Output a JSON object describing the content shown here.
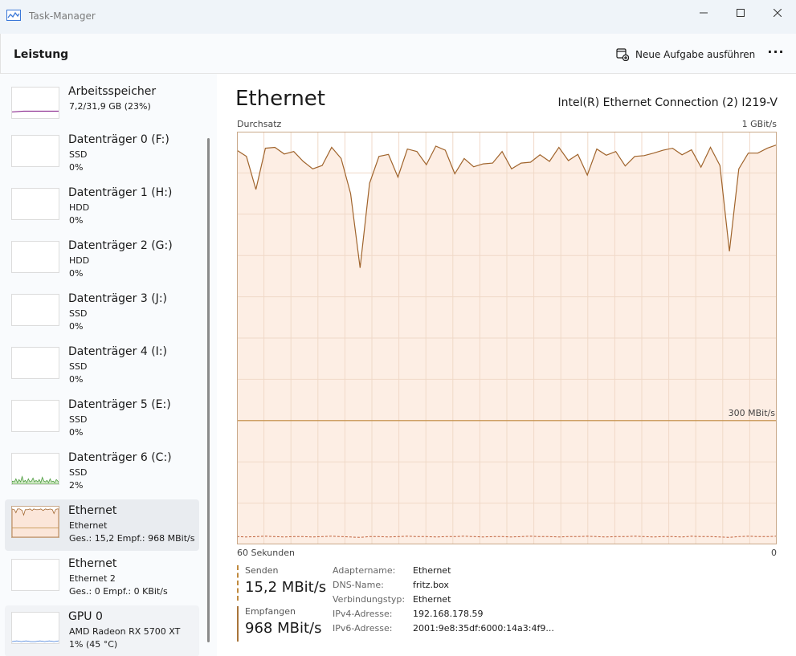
{
  "window": {
    "title": "Task-Manager"
  },
  "header": {
    "page_heading": "Leistung",
    "run_task_label": "Neue Aufgabe ausführen",
    "more_label": "···"
  },
  "sidebar": {
    "items": [
      {
        "title": "Arbeitsspeicher",
        "sub1": "7,2/31,9 GB (23%)",
        "sub2": ""
      },
      {
        "title": "Datenträger 0 (F:)",
        "sub1": "SSD",
        "sub2": "0%"
      },
      {
        "title": "Datenträger 1 (H:)",
        "sub1": "HDD",
        "sub2": "0%"
      },
      {
        "title": "Datenträger 2 (G:)",
        "sub1": "HDD",
        "sub2": "0%"
      },
      {
        "title": "Datenträger 3 (J:)",
        "sub1": "SSD",
        "sub2": "0%"
      },
      {
        "title": "Datenträger 4 (I:)",
        "sub1": "SSD",
        "sub2": "0%"
      },
      {
        "title": "Datenträger 5 (E:)",
        "sub1": "SSD",
        "sub2": "0%"
      },
      {
        "title": "Datenträger 6 (C:)",
        "sub1": "SSD",
        "sub2": "2%"
      },
      {
        "title": "Ethernet",
        "sub1": "Ethernet",
        "sub2": "Ges.: 15,2 Empf.: 968 MBit/s"
      },
      {
        "title": "Ethernet",
        "sub1": "Ethernet 2",
        "sub2": "Ges.: 0 Empf.: 0 KBit/s"
      },
      {
        "title": "GPU 0",
        "sub1": "AMD Radeon RX 5700 XT",
        "sub2": "1% (45 °C)"
      }
    ],
    "selected_index": 8
  },
  "main": {
    "title": "Ethernet",
    "adapter": "Intel(R) Ethernet Connection (2) I219-V",
    "throughput_label": "Durchsatz",
    "max_label": "1 GBit/s",
    "mid_label": "300 MBit/s",
    "time_label": "60 Sekunden",
    "zero_label": "0",
    "send_label": "Senden",
    "send_value": "15,2 MBit/s",
    "recv_label": "Empfangen",
    "recv_value": "968 MBit/s",
    "properties": [
      {
        "key": "Adaptername:",
        "value": "Ethernet"
      },
      {
        "key": "DNS-Name:",
        "value": "fritz.box"
      },
      {
        "key": "Verbindungstyp:",
        "value": "Ethernet"
      },
      {
        "key": "IPv4-Adresse:",
        "value": "192.168.178.59"
      },
      {
        "key": "IPv6-Adresse:",
        "value": "2001:9e8:35df:6000:14a3:4f9..."
      }
    ]
  },
  "chart_data": {
    "type": "line",
    "ylim": [
      0,
      1000
    ],
    "xlabel": "60 Sekunden",
    "ylabel": "Durchsatz",
    "series": [
      {
        "name": "Empfangen",
        "values": [
          955,
          940,
          860,
          960,
          962,
          946,
          952,
          928,
          910,
          918,
          962,
          935,
          850,
          670,
          875,
          940,
          945,
          890,
          958,
          952,
          920,
          965,
          955,
          898,
          935,
          915,
          922,
          924,
          952,
          910,
          924,
          926,
          944,
          928,
          962,
          930,
          945,
          895,
          958,
          943,
          952,
          917,
          940,
          942,
          948,
          955,
          960,
          944,
          956,
          914,
          962,
          918,
          710,
          910,
          948,
          948,
          960,
          968
        ]
      },
      {
        "values": [
          15,
          14,
          15,
          16,
          15,
          14,
          15,
          15,
          14,
          15,
          16,
          15,
          14,
          13,
          15,
          15,
          14,
          15,
          16,
          15,
          15,
          14,
          15,
          15,
          16,
          15,
          14,
          15,
          15,
          14,
          15,
          16,
          15,
          15,
          14,
          15,
          15,
          16,
          15,
          14,
          15,
          15,
          16,
          15,
          14,
          15,
          15,
          14,
          16,
          15,
          15,
          14,
          13,
          15,
          16,
          15,
          15,
          16
        ]
      }
    ],
    "colors": {
      "line": "#a0642c",
      "fill": "#fdeee4",
      "grid": "#f0d9c8",
      "border": "#c9a98a"
    }
  }
}
